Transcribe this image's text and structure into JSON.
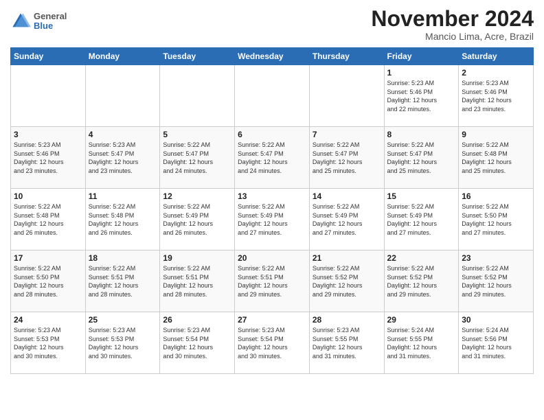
{
  "header": {
    "logo_line1": "General",
    "logo_line2": "Blue",
    "month": "November 2024",
    "location": "Mancio Lima, Acre, Brazil"
  },
  "weekdays": [
    "Sunday",
    "Monday",
    "Tuesday",
    "Wednesday",
    "Thursday",
    "Friday",
    "Saturday"
  ],
  "weeks": [
    [
      {
        "day": "",
        "info": ""
      },
      {
        "day": "",
        "info": ""
      },
      {
        "day": "",
        "info": ""
      },
      {
        "day": "",
        "info": ""
      },
      {
        "day": "",
        "info": ""
      },
      {
        "day": "1",
        "info": "Sunrise: 5:23 AM\nSunset: 5:46 PM\nDaylight: 12 hours\nand 22 minutes."
      },
      {
        "day": "2",
        "info": "Sunrise: 5:23 AM\nSunset: 5:46 PM\nDaylight: 12 hours\nand 23 minutes."
      }
    ],
    [
      {
        "day": "3",
        "info": "Sunrise: 5:23 AM\nSunset: 5:46 PM\nDaylight: 12 hours\nand 23 minutes."
      },
      {
        "day": "4",
        "info": "Sunrise: 5:23 AM\nSunset: 5:47 PM\nDaylight: 12 hours\nand 23 minutes."
      },
      {
        "day": "5",
        "info": "Sunrise: 5:22 AM\nSunset: 5:47 PM\nDaylight: 12 hours\nand 24 minutes."
      },
      {
        "day": "6",
        "info": "Sunrise: 5:22 AM\nSunset: 5:47 PM\nDaylight: 12 hours\nand 24 minutes."
      },
      {
        "day": "7",
        "info": "Sunrise: 5:22 AM\nSunset: 5:47 PM\nDaylight: 12 hours\nand 25 minutes."
      },
      {
        "day": "8",
        "info": "Sunrise: 5:22 AM\nSunset: 5:47 PM\nDaylight: 12 hours\nand 25 minutes."
      },
      {
        "day": "9",
        "info": "Sunrise: 5:22 AM\nSunset: 5:48 PM\nDaylight: 12 hours\nand 25 minutes."
      }
    ],
    [
      {
        "day": "10",
        "info": "Sunrise: 5:22 AM\nSunset: 5:48 PM\nDaylight: 12 hours\nand 26 minutes."
      },
      {
        "day": "11",
        "info": "Sunrise: 5:22 AM\nSunset: 5:48 PM\nDaylight: 12 hours\nand 26 minutes."
      },
      {
        "day": "12",
        "info": "Sunrise: 5:22 AM\nSunset: 5:49 PM\nDaylight: 12 hours\nand 26 minutes."
      },
      {
        "day": "13",
        "info": "Sunrise: 5:22 AM\nSunset: 5:49 PM\nDaylight: 12 hours\nand 27 minutes."
      },
      {
        "day": "14",
        "info": "Sunrise: 5:22 AM\nSunset: 5:49 PM\nDaylight: 12 hours\nand 27 minutes."
      },
      {
        "day": "15",
        "info": "Sunrise: 5:22 AM\nSunset: 5:49 PM\nDaylight: 12 hours\nand 27 minutes."
      },
      {
        "day": "16",
        "info": "Sunrise: 5:22 AM\nSunset: 5:50 PM\nDaylight: 12 hours\nand 27 minutes."
      }
    ],
    [
      {
        "day": "17",
        "info": "Sunrise: 5:22 AM\nSunset: 5:50 PM\nDaylight: 12 hours\nand 28 minutes."
      },
      {
        "day": "18",
        "info": "Sunrise: 5:22 AM\nSunset: 5:51 PM\nDaylight: 12 hours\nand 28 minutes."
      },
      {
        "day": "19",
        "info": "Sunrise: 5:22 AM\nSunset: 5:51 PM\nDaylight: 12 hours\nand 28 minutes."
      },
      {
        "day": "20",
        "info": "Sunrise: 5:22 AM\nSunset: 5:51 PM\nDaylight: 12 hours\nand 29 minutes."
      },
      {
        "day": "21",
        "info": "Sunrise: 5:22 AM\nSunset: 5:52 PM\nDaylight: 12 hours\nand 29 minutes."
      },
      {
        "day": "22",
        "info": "Sunrise: 5:22 AM\nSunset: 5:52 PM\nDaylight: 12 hours\nand 29 minutes."
      },
      {
        "day": "23",
        "info": "Sunrise: 5:22 AM\nSunset: 5:52 PM\nDaylight: 12 hours\nand 29 minutes."
      }
    ],
    [
      {
        "day": "24",
        "info": "Sunrise: 5:23 AM\nSunset: 5:53 PM\nDaylight: 12 hours\nand 30 minutes."
      },
      {
        "day": "25",
        "info": "Sunrise: 5:23 AM\nSunset: 5:53 PM\nDaylight: 12 hours\nand 30 minutes."
      },
      {
        "day": "26",
        "info": "Sunrise: 5:23 AM\nSunset: 5:54 PM\nDaylight: 12 hours\nand 30 minutes."
      },
      {
        "day": "27",
        "info": "Sunrise: 5:23 AM\nSunset: 5:54 PM\nDaylight: 12 hours\nand 30 minutes."
      },
      {
        "day": "28",
        "info": "Sunrise: 5:23 AM\nSunset: 5:55 PM\nDaylight: 12 hours\nand 31 minutes."
      },
      {
        "day": "29",
        "info": "Sunrise: 5:24 AM\nSunset: 5:55 PM\nDaylight: 12 hours\nand 31 minutes."
      },
      {
        "day": "30",
        "info": "Sunrise: 5:24 AM\nSunset: 5:56 PM\nDaylight: 12 hours\nand 31 minutes."
      }
    ]
  ]
}
